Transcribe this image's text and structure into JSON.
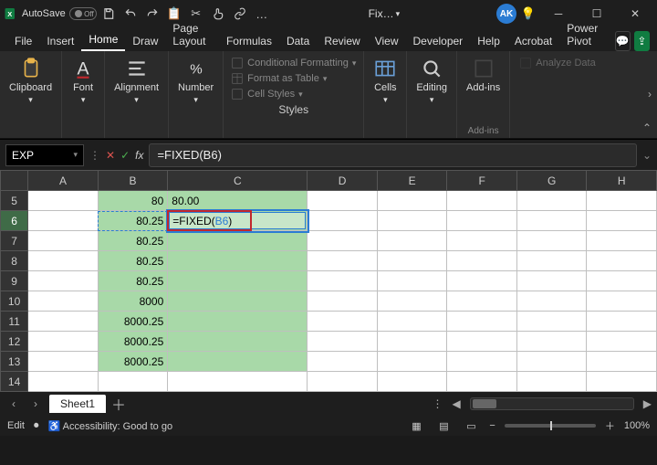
{
  "titlebar": {
    "autosave_label": "AutoSave",
    "autosave_state": "Off",
    "filename": "Fix…",
    "avatar_initials": "AK"
  },
  "menu": {
    "items": [
      "File",
      "Insert",
      "Home",
      "Draw",
      "Page Layout",
      "Formulas",
      "Data",
      "Review",
      "View",
      "Developer",
      "Help",
      "Acrobat",
      "Power Pivot"
    ],
    "active_index": 2
  },
  "ribbon": {
    "groups": {
      "clipboard": "Clipboard",
      "font": "Font",
      "alignment": "Alignment",
      "number": "Number",
      "styles_label": "Styles",
      "cond_fmt": "Conditional Formatting",
      "fmt_table": "Format as Table",
      "cell_styles": "Cell Styles",
      "cells": "Cells",
      "editing": "Editing",
      "addins": "Add-ins",
      "addins_label": "Add-ins",
      "analyze": "Analyze Data"
    }
  },
  "formulabar": {
    "namebox": "EXP",
    "formula": "=FIXED(B6)"
  },
  "sheet": {
    "columns": [
      "A",
      "B",
      "C",
      "D",
      "E",
      "F",
      "G",
      "H"
    ],
    "rows": [
      5,
      6,
      7,
      8,
      9,
      10,
      11,
      12,
      13,
      14
    ],
    "active_row": 6,
    "b_values": {
      "5": "80",
      "6": "80.25",
      "7": "80.25",
      "8": "80.25",
      "9": "80.25",
      "10": "8000",
      "11": "8000.25",
      "12": "8000.25",
      "13": "8000.25"
    },
    "c5": "80.00",
    "c6_edit_prefix": "=FIXED(",
    "c6_edit_ref": "B6",
    "c6_edit_suffix": ")"
  },
  "tabs": {
    "sheet1": "Sheet1"
  },
  "status": {
    "mode": "Edit",
    "accessibility": "Accessibility: Good to go",
    "zoom": "100%"
  }
}
